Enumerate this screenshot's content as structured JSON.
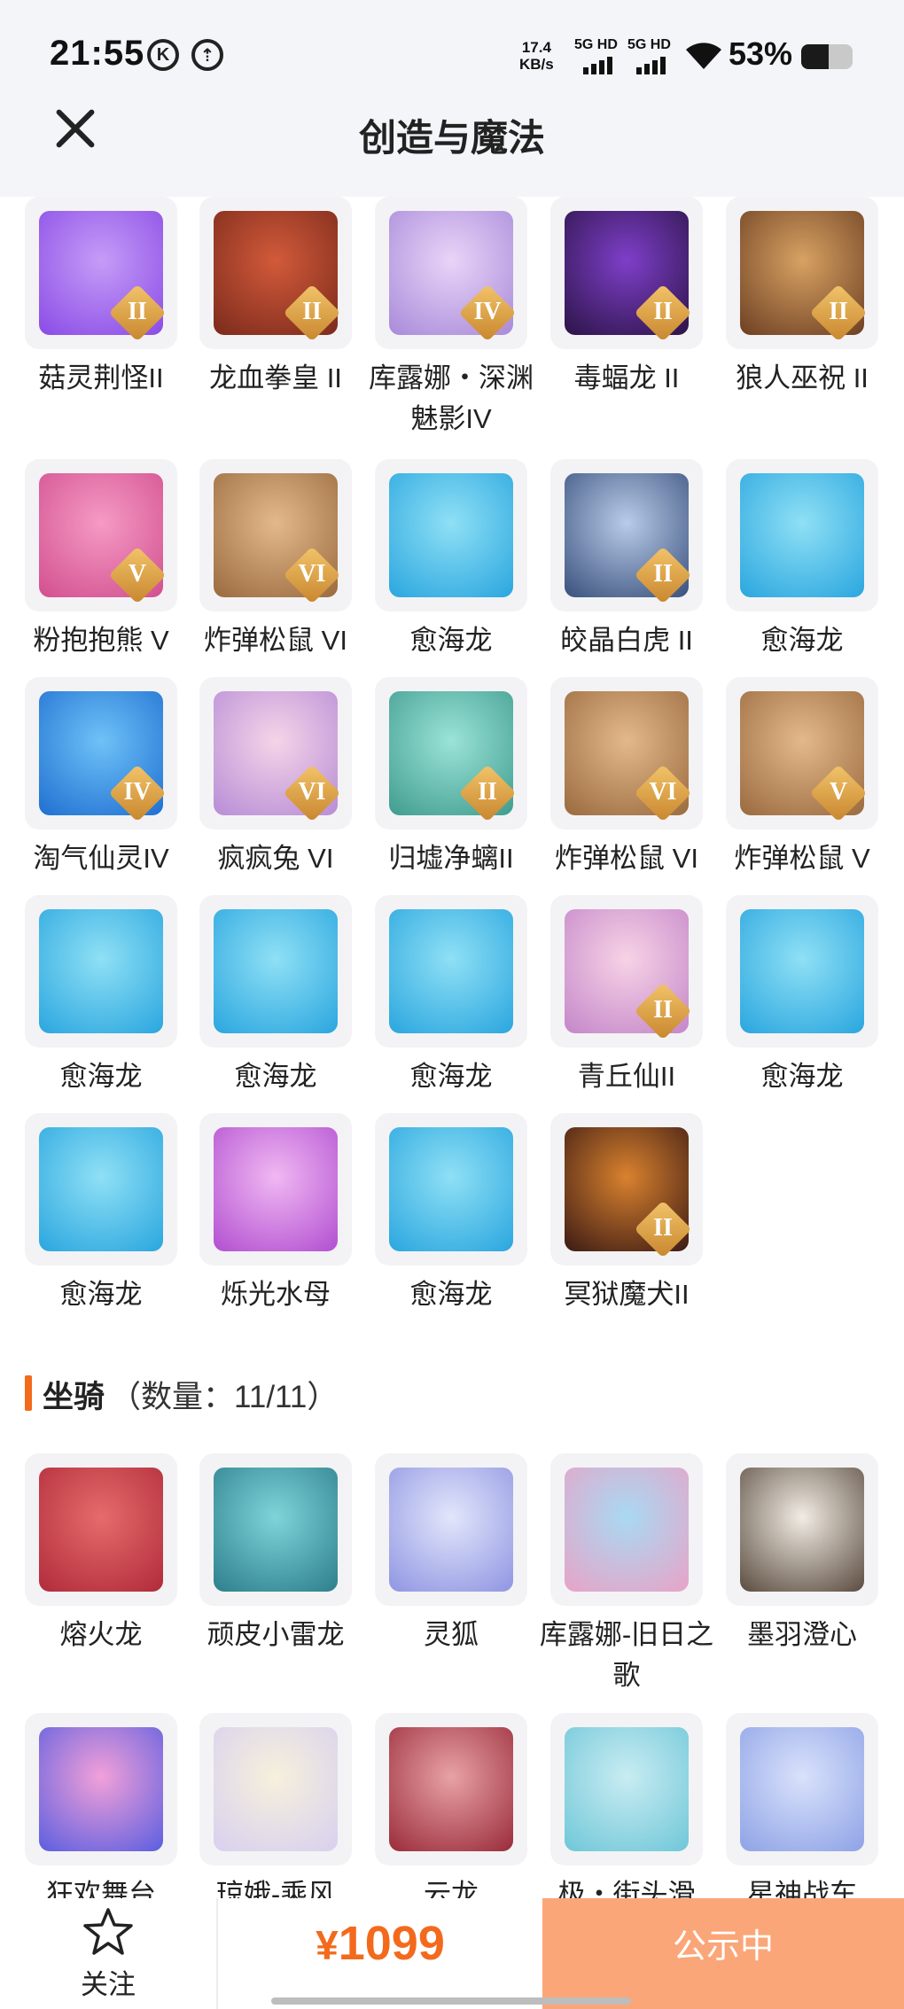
{
  "status_bar": {
    "time": "21:55",
    "icons": [
      "k-badge-icon",
      "upload-badge-icon"
    ],
    "net_speed_value": "17.4",
    "net_speed_unit": "KB/s",
    "sim1": "5G HD",
    "sim2": "5G HD",
    "battery_pct": "53%",
    "battery_level": 0.53
  },
  "header": {
    "title": "创造与魔法",
    "close_icon": "close-icon"
  },
  "pets": [
    {
      "name": "菇灵荆怪II",
      "icon": "mushroom-sprite",
      "badge": "II",
      "colors": [
        "#c59cf7",
        "#8a4be6"
      ]
    },
    {
      "name": "龙血拳皇 II",
      "icon": "red-dragon-boxer",
      "badge": "II",
      "colors": [
        "#d25a3a",
        "#7b2a1c"
      ]
    },
    {
      "name": "库露娜・深渊魅影IV",
      "icon": "kuluna-abyss",
      "badge": "IV",
      "colors": [
        "#e9d4f8",
        "#a88ad9"
      ]
    },
    {
      "name": "毒蝠龙 II",
      "icon": "poison-bat-dragon",
      "badge": "II",
      "colors": [
        "#7e3fc9",
        "#2c1447"
      ]
    },
    {
      "name": "狼人巫祝 II",
      "icon": "werewolf-shaman",
      "badge": "II",
      "colors": [
        "#d8a263",
        "#6c3f22"
      ]
    },
    {
      "name": "粉抱抱熊 V",
      "icon": "pink-bear",
      "badge": "V",
      "colors": [
        "#f59ac4",
        "#d24f8f"
      ]
    },
    {
      "name": "炸弹松鼠 VI",
      "icon": "bomb-squirrel",
      "badge": "VI",
      "colors": [
        "#e3b98b",
        "#9a6a3f"
      ]
    },
    {
      "name": "愈海龙",
      "icon": "healing-sea-dragon",
      "badge": "",
      "colors": [
        "#8fe0f5",
        "#2aa6df"
      ]
    },
    {
      "name": "皎晶白虎 II",
      "icon": "crystal-white-tiger",
      "badge": "II",
      "colors": [
        "#b9cbe8",
        "#38507c"
      ]
    },
    {
      "name": "愈海龙",
      "icon": "healing-sea-dragon",
      "badge": "",
      "colors": [
        "#8fe0f5",
        "#2aa6df"
      ]
    },
    {
      "name": "淘气仙灵IV",
      "icon": "naughty-fairy",
      "badge": "IV",
      "colors": [
        "#6ec2f7",
        "#1f6fd1"
      ]
    },
    {
      "name": "疯疯兔 VI",
      "icon": "crazy-rabbit",
      "badge": "VI",
      "colors": [
        "#f5d4e8",
        "#b78cd6"
      ]
    },
    {
      "name": "归墟净螭II",
      "icon": "guixu-chi-dragon",
      "badge": "II",
      "colors": [
        "#9be3d8",
        "#3f9c8e"
      ]
    },
    {
      "name": "炸弹松鼠 VI",
      "icon": "bomb-squirrel",
      "badge": "VI",
      "colors": [
        "#e3b98b",
        "#9a6a3f"
      ]
    },
    {
      "name": "炸弹松鼠 V",
      "icon": "bomb-squirrel",
      "badge": "V",
      "colors": [
        "#e3b98b",
        "#9a6a3f"
      ]
    },
    {
      "name": "愈海龙",
      "icon": "healing-sea-dragon",
      "badge": "",
      "colors": [
        "#8fe0f5",
        "#2aa6df"
      ]
    },
    {
      "name": "愈海龙",
      "icon": "healing-sea-dragon",
      "badge": "",
      "colors": [
        "#8fe0f5",
        "#2aa6df"
      ]
    },
    {
      "name": "愈海龙",
      "icon": "healing-sea-dragon",
      "badge": "",
      "colors": [
        "#8fe0f5",
        "#2aa6df"
      ]
    },
    {
      "name": "青丘仙II",
      "icon": "qingqiu-fox-fairy",
      "badge": "II",
      "colors": [
        "#f7d3e6",
        "#c486c9"
      ]
    },
    {
      "name": "愈海龙",
      "icon": "healing-sea-dragon",
      "badge": "",
      "colors": [
        "#8fe0f5",
        "#2aa6df"
      ]
    },
    {
      "name": "愈海龙",
      "icon": "healing-sea-dragon",
      "badge": "",
      "colors": [
        "#8fe0f5",
        "#2aa6df"
      ]
    },
    {
      "name": "烁光水母",
      "icon": "glowing-jellyfish",
      "badge": "",
      "colors": [
        "#f0b8f2",
        "#b24fd1"
      ]
    },
    {
      "name": "愈海龙",
      "icon": "healing-sea-dragon",
      "badge": "",
      "colors": [
        "#8fe0f5",
        "#2aa6df"
      ]
    },
    {
      "name": "冥狱魔犬II",
      "icon": "hell-hound",
      "badge": "II",
      "colors": [
        "#d9822e",
        "#3b1a14"
      ]
    }
  ],
  "mounts_section": {
    "title": "坐骑",
    "count_label": "（数量：11/11）"
  },
  "mounts": [
    {
      "name": "熔火龙",
      "icon": "magma-dragon",
      "colors": [
        "#e66b6b",
        "#b02b3a"
      ]
    },
    {
      "name": "顽皮小雷龙",
      "icon": "naughty-thunder-dragon",
      "colors": [
        "#7fd3d9",
        "#2c7f8c"
      ]
    },
    {
      "name": "灵狐",
      "icon": "spirit-fox",
      "colors": [
        "#e2e6fb",
        "#8f95e2"
      ]
    },
    {
      "name": "库露娜-旧日之歌",
      "icon": "kuluna-old-song",
      "colors": [
        "#a9d9f2",
        "#e8a3c7"
      ]
    },
    {
      "name": "墨羽澄心",
      "icon": "ink-feather",
      "colors": [
        "#f1ece4",
        "#5a4b3f"
      ]
    },
    {
      "name": "狂欢舞台",
      "icon": "carnival-stage",
      "colors": [
        "#f2a0d8",
        "#5b5ee0"
      ]
    },
    {
      "name": "琼娥-乘风",
      "icon": "qionge-wind",
      "colors": [
        "#f6f0dc",
        "#d8d0ef"
      ]
    },
    {
      "name": "云龙",
      "icon": "cloud-dragon",
      "colors": [
        "#e8a2a6",
        "#9a2b3a"
      ]
    },
    {
      "name": "极・街头滑",
      "icon": "street-skateboard",
      "colors": [
        "#c9ecf2",
        "#6fc7d8"
      ]
    },
    {
      "name": "星神战车",
      "icon": "star-god-chariot",
      "colors": [
        "#d9e2fb",
        "#8ea2e6"
      ]
    }
  ],
  "bottom_bar": {
    "follow_label": "关注",
    "follow_icon": "star-outline-icon",
    "currency": "¥",
    "price": "1099",
    "status_label": "公示中",
    "accent": "#f36a1d",
    "status_bg": "#fba678"
  }
}
